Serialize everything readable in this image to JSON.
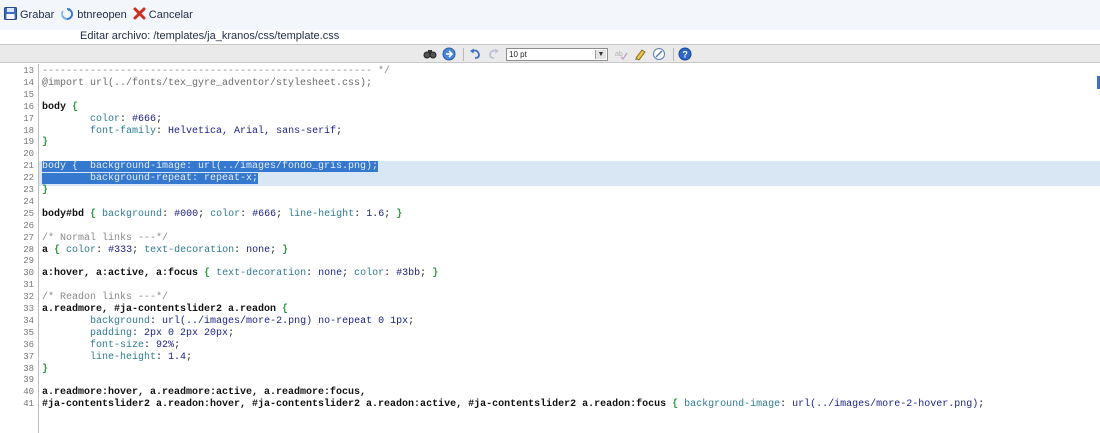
{
  "toolbar": {
    "save_label": "Grabar",
    "reopen_label": "btnreopen",
    "cancel_label": "Cancelar"
  },
  "title": "Editar archivo: /templates/ja_kranos/css/template.css",
  "editor_toolbar": {
    "font_size": "10 pt",
    "icons": [
      "search-icon",
      "replace-icon",
      "undo-icon",
      "redo-icon",
      "font-size-select",
      "spellcheck-icon",
      "highlight-icon",
      "reset-icon",
      "help-icon"
    ]
  },
  "colors": {
    "selection": "#3478cf",
    "highlight_band": "#d9e7f5",
    "brace": "#2f9b45",
    "property": "#2e7c8f",
    "value": "#1a1f8a"
  },
  "lines": [
    {
      "n": "13",
      "text": "------------------------------------------------------- */"
    },
    {
      "n": "14",
      "text": "@import url(../fonts/tex_gyre_adventor/stylesheet.css);"
    },
    {
      "n": "15",
      "text": ""
    },
    {
      "n": "16",
      "text": "body {"
    },
    {
      "n": "17",
      "text": "        color: #666;"
    },
    {
      "n": "18",
      "text": "        font-family: Helvetica, Arial, sans-serif;"
    },
    {
      "n": "19",
      "text": "}"
    },
    {
      "n": "20",
      "text": ""
    },
    {
      "n": "21",
      "text": "body {  background-image: url(../images/fondo_gris.png);"
    },
    {
      "n": "22",
      "text": "        background-repeat: repeat-x;"
    },
    {
      "n": "23",
      "text": "}"
    },
    {
      "n": "24",
      "text": ""
    },
    {
      "n": "25",
      "text": "body#bd { background: #000; color: #666; line-height: 1.6; }"
    },
    {
      "n": "26",
      "text": ""
    },
    {
      "n": "27",
      "text": "/* Normal links ---*/"
    },
    {
      "n": "28",
      "text": "a { color: #333; text-decoration: none; }"
    },
    {
      "n": "29",
      "text": ""
    },
    {
      "n": "30",
      "text": "a:hover, a:active, a:focus { text-decoration: none; color: #3bb; }"
    },
    {
      "n": "31",
      "text": ""
    },
    {
      "n": "32",
      "text": "/* Readon links ---*/"
    },
    {
      "n": "33",
      "text": "a.readmore, #ja-contentslider2 a.readon {"
    },
    {
      "n": "34",
      "text": "        background: url(../images/more-2.png) no-repeat 0 1px;"
    },
    {
      "n": "35",
      "text": "        padding: 2px 0 2px 20px;"
    },
    {
      "n": "36",
      "text": "        font-size: 92%;"
    },
    {
      "n": "37",
      "text": "        line-height: 1.4;"
    },
    {
      "n": "38",
      "text": "}"
    },
    {
      "n": "39",
      "text": ""
    },
    {
      "n": "40",
      "text": "a.readmore:hover, a.readmore:active, a.readmore:focus,"
    },
    {
      "n": "41",
      "text": "#ja-contentslider2 a.readon:hover, #ja-contentslider2 a.readon:active, #ja-contentslider2 a.readon:focus { background-image: url(../images/more-2-hover.png);"
    }
  ]
}
